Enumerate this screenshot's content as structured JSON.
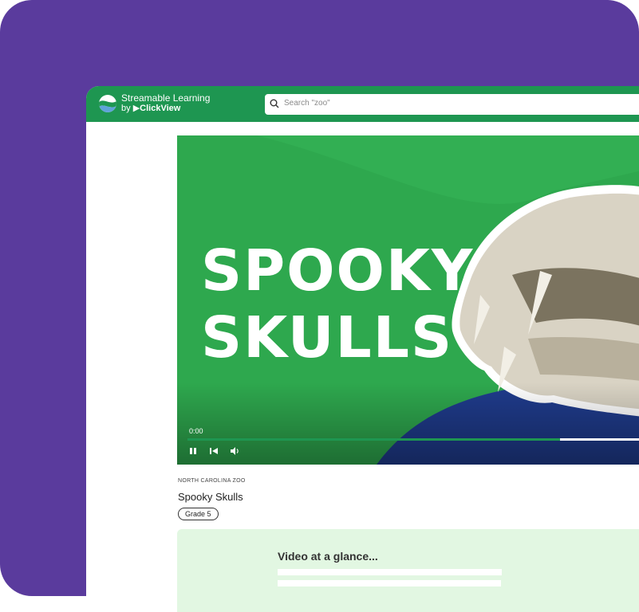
{
  "brand": {
    "name": "Streamable Learning",
    "by": "by",
    "partner": "ClickView",
    "accent": "#1e9651",
    "background": "#5a3b9d"
  },
  "search": {
    "placeholder": "Search \"zoo\"",
    "icon": "search-icon"
  },
  "video": {
    "title_line1": "SPOOKY",
    "title_line2": "SKULLS",
    "time": "0:00",
    "progress": 0.82,
    "controls": [
      "pause-icon",
      "skip-back-icon",
      "volume-icon"
    ]
  },
  "details": {
    "provider": "NORTH CAROLINA ZOO",
    "name": "Spooky Skulls",
    "grade": "Grade 5"
  },
  "glance": {
    "title": "Video at a glance..."
  }
}
